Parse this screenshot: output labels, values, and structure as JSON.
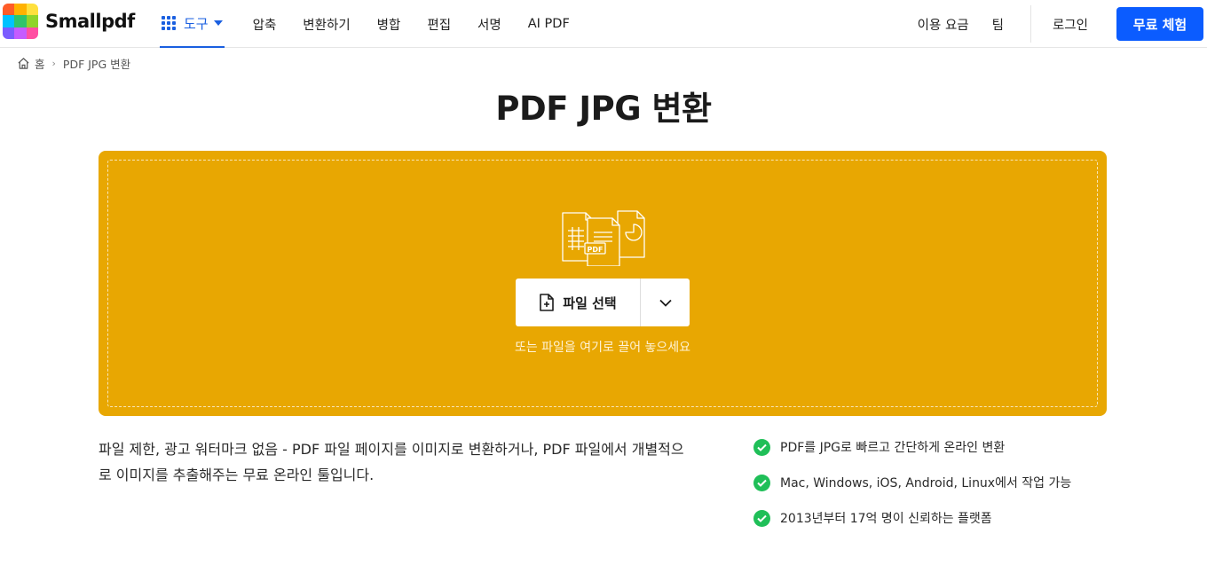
{
  "brand": {
    "name": "Smallpdf"
  },
  "nav": {
    "tools_label": "도구",
    "links": [
      "압축",
      "변환하기",
      "병합",
      "편집",
      "서명",
      "AI PDF"
    ],
    "pricing": "이용 요금",
    "team": "팀",
    "login": "로그인",
    "trial": "무료 체험"
  },
  "breadcrumb": {
    "home": "홈",
    "current": "PDF JPG 변환"
  },
  "page_title": "PDF JPG 변환",
  "dropzone": {
    "file_badge": "PDF",
    "choose_file": "파일 선택",
    "hint": "또는 파일을 여기로 끌어 놓으세요"
  },
  "description": "파일 제한, 광고 워터마크 없음 - PDF 파일 페이지를 이미지로 변환하거나, PDF 파일에서 개별적으로 이미지를 추출해주는 무료 온라인 툴입니다.",
  "features": [
    "PDF를 JPG로 빠르고 간단하게 온라인 변환",
    "Mac, Windows, iOS, Android, Linux에서 작업 가능",
    "2013년부터 17억 명이 신뢰하는 플랫폼"
  ],
  "colors": {
    "accent": "#0b5cff",
    "dropzone": "#e8a702",
    "check": "#1fbf58"
  }
}
